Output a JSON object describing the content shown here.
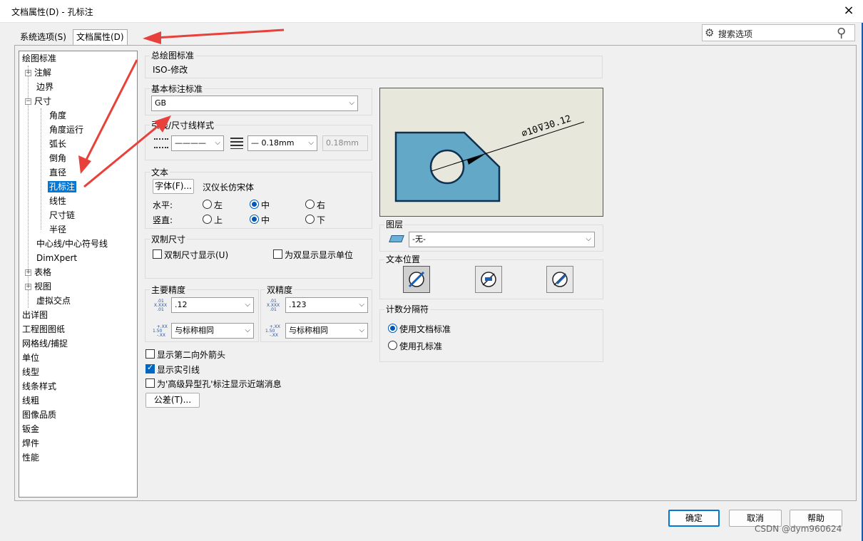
{
  "window": {
    "title": "文档属性(D) - 孔标注",
    "close": "×"
  },
  "tabs": [
    {
      "label": "系统选项(S)"
    },
    {
      "label": "文档属性(D)"
    }
  ],
  "search": {
    "placeholder": "搜索选项"
  },
  "tree": {
    "items": [
      {
        "label": "绘图标准"
      },
      {
        "label": "注解"
      },
      {
        "label": "边界"
      },
      {
        "label": "尺寸"
      },
      {
        "label": "角度"
      },
      {
        "label": "角度运行"
      },
      {
        "label": "弧长"
      },
      {
        "label": "倒角"
      },
      {
        "label": "直径"
      },
      {
        "label": "孔标注"
      },
      {
        "label": "线性"
      },
      {
        "label": "尺寸链"
      },
      {
        "label": "半径"
      },
      {
        "label": "中心线/中心符号线"
      },
      {
        "label": "DimXpert"
      },
      {
        "label": "表格"
      },
      {
        "label": "视图"
      },
      {
        "label": "虚拟交点"
      },
      {
        "label": "出详图"
      },
      {
        "label": "工程图图纸"
      },
      {
        "label": "网格线/捕捉"
      },
      {
        "label": "单位"
      },
      {
        "label": "线型"
      },
      {
        "label": "线条样式"
      },
      {
        "label": "线粗"
      },
      {
        "label": "图像品质"
      },
      {
        "label": "钣金"
      },
      {
        "label": "焊件"
      },
      {
        "label": "性能"
      }
    ]
  },
  "overall_standard": {
    "title": "总绘图标准",
    "value": "ISO-修改"
  },
  "base_standard": {
    "title": "基本标注标准",
    "value": "GB"
  },
  "leader_style": {
    "title": "引线/尺寸线样式",
    "line_style": "————",
    "thickness": "— 0.18mm",
    "custom": "0.18mm"
  },
  "text": {
    "title": "文本",
    "font_button": "字体(F)...",
    "font_name": "汉仪长仿宋体",
    "horizontal_label": "水平:",
    "vertical_label": "竖直:",
    "h_left": "左",
    "h_center": "中",
    "h_right": "右",
    "v_top": "上",
    "v_middle": "中",
    "v_bottom": "下"
  },
  "dual": {
    "title": "双制尺寸",
    "show_dual": "双制尺寸显示(U)",
    "show_units": "为双显示显示单位"
  },
  "primary_precision": {
    "title": "主要精度",
    "value": ".12",
    "tolerance": "与标称相同",
    "icon1": ".01 X.XXX .01",
    "icon2": "1.50 +.XX -.XX"
  },
  "dual_precision": {
    "title": "双精度",
    "value": ".123",
    "tolerance": "与标称相同"
  },
  "options": {
    "second_arrow": "显示第二向外箭头",
    "solid_leader": "显示实引线",
    "advanced_note": "为'高级异型孔'标注显示近端消息",
    "tolerance_button": "公差(T)..."
  },
  "preview": {
    "dimension_text": "⌀10⊽30.12"
  },
  "layer": {
    "title": "图层",
    "value": "-无-"
  },
  "text_position": {
    "title": "文本位置"
  },
  "count_separator": {
    "title": "计数分隔符",
    "use_document": "使用文档标准",
    "use_hole": "使用孔标准"
  },
  "buttons": {
    "ok": "确定",
    "cancel": "取消",
    "help": "帮助"
  },
  "watermark": "CSDN @dym960624",
  "colors": {
    "selection": "#0078d7",
    "part_fill": "#64a8c8",
    "arrow": "#e8403a"
  }
}
